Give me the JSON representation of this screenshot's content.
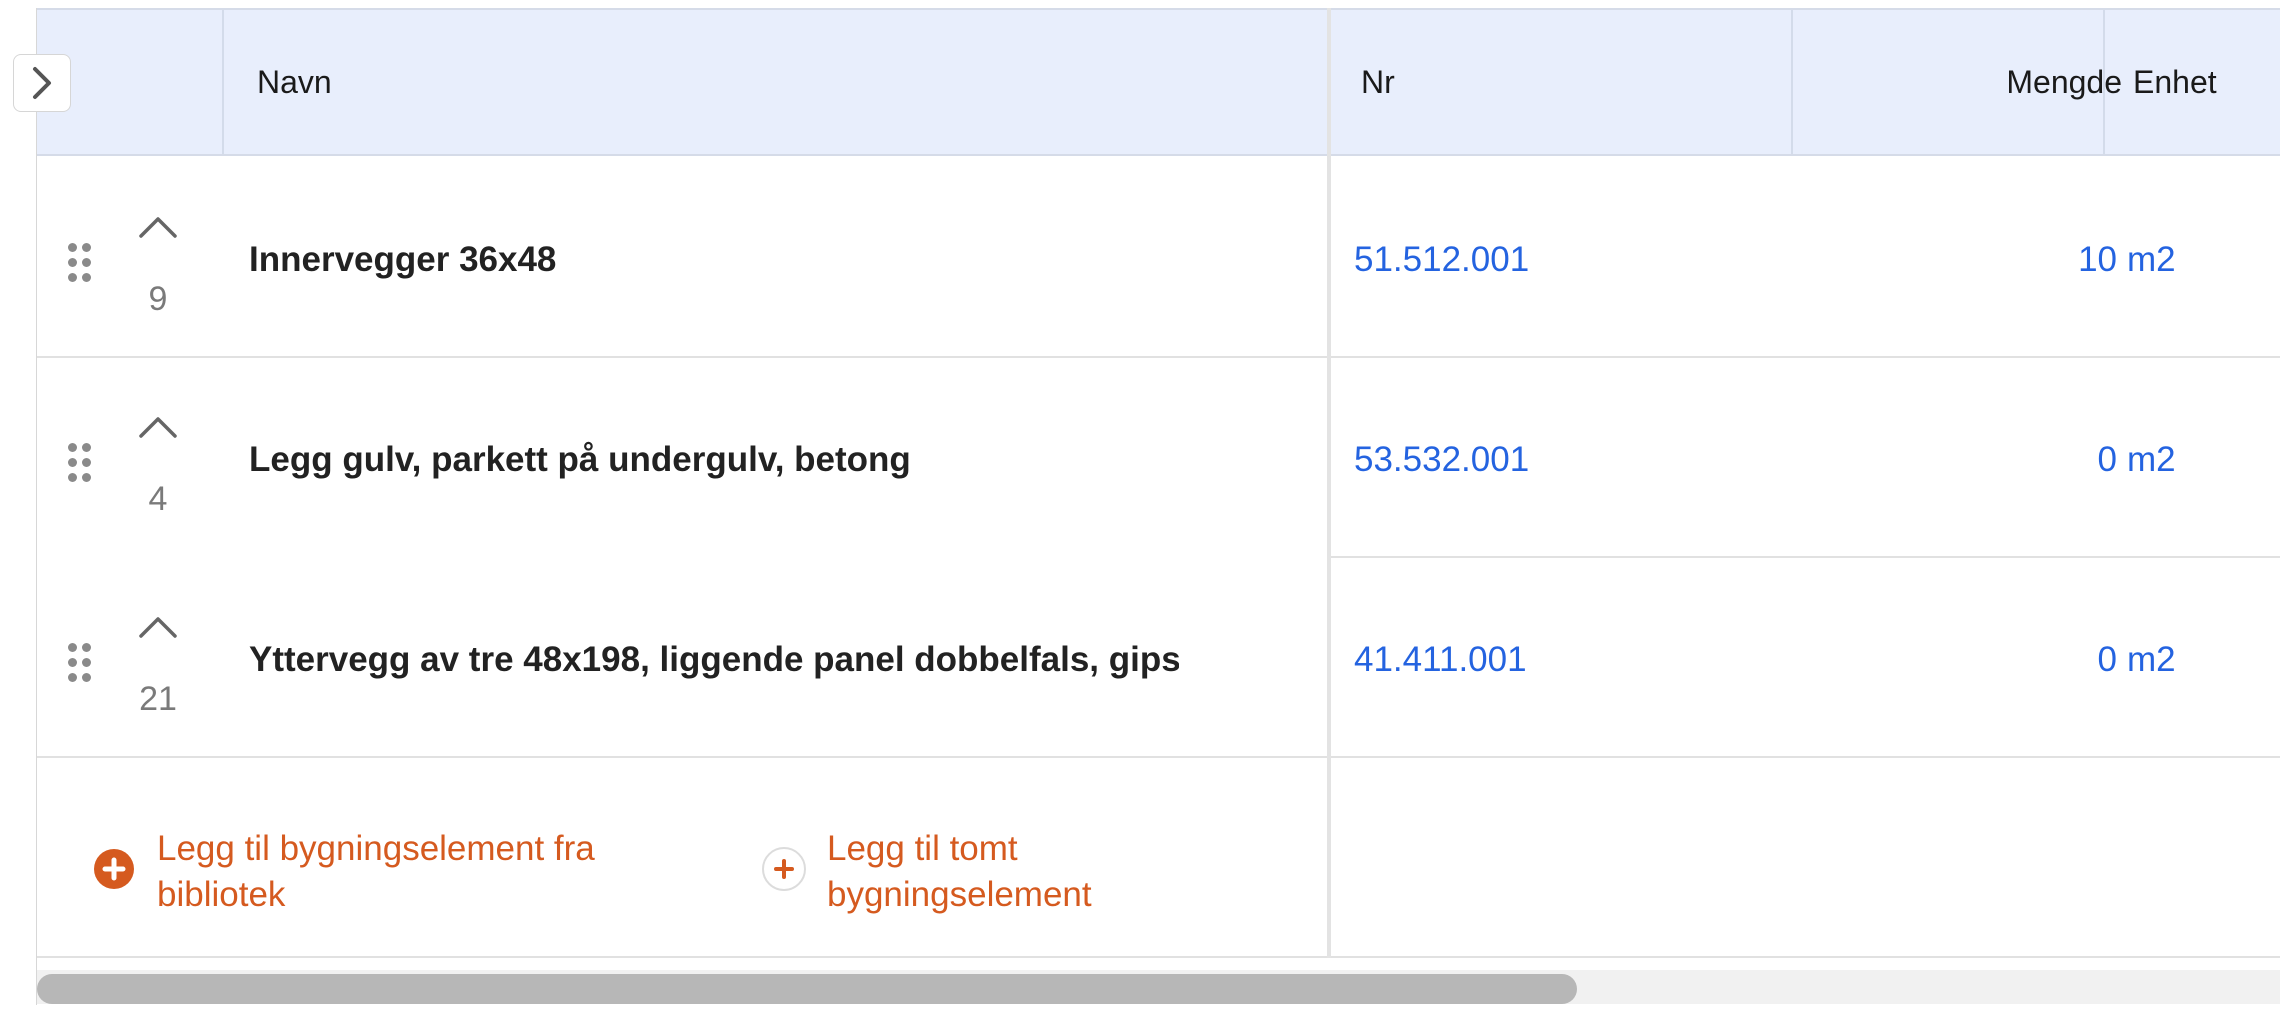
{
  "header": {
    "columns": {
      "name": "Navn",
      "nr": "Nr",
      "quantity": "Mengde",
      "unit": "Enhet"
    }
  },
  "rows": [
    {
      "count": "9",
      "name": "Innervegger 36x48",
      "nr": "51.512.001",
      "quantity": "10",
      "unit": "m2"
    },
    {
      "count": "4",
      "name": "Legg gulv, parkett på undergulv, betong",
      "nr": "53.532.001",
      "quantity": "0",
      "unit": "m2"
    },
    {
      "count": "21",
      "name": "Yttervegg av tre 48x198, liggende panel dobbelfals, gips",
      "nr": "41.411.001",
      "quantity": "0",
      "unit": "m2"
    }
  ],
  "actions": {
    "add_from_library": "Legg til bygningselement fra bibliotek",
    "add_empty": "Legg til tomt bygningselement"
  },
  "icons": {
    "expand": "chevron-right-icon",
    "drag": "drag-handle-icon",
    "collapse": "chevron-up-icon",
    "add_filled": "plus-circle-filled-icon",
    "add_outline": "plus-circle-outline-icon"
  },
  "colors": {
    "header_bg": "#e8eefc",
    "link_blue": "#2463e0",
    "action_orange": "#d55a1f"
  }
}
